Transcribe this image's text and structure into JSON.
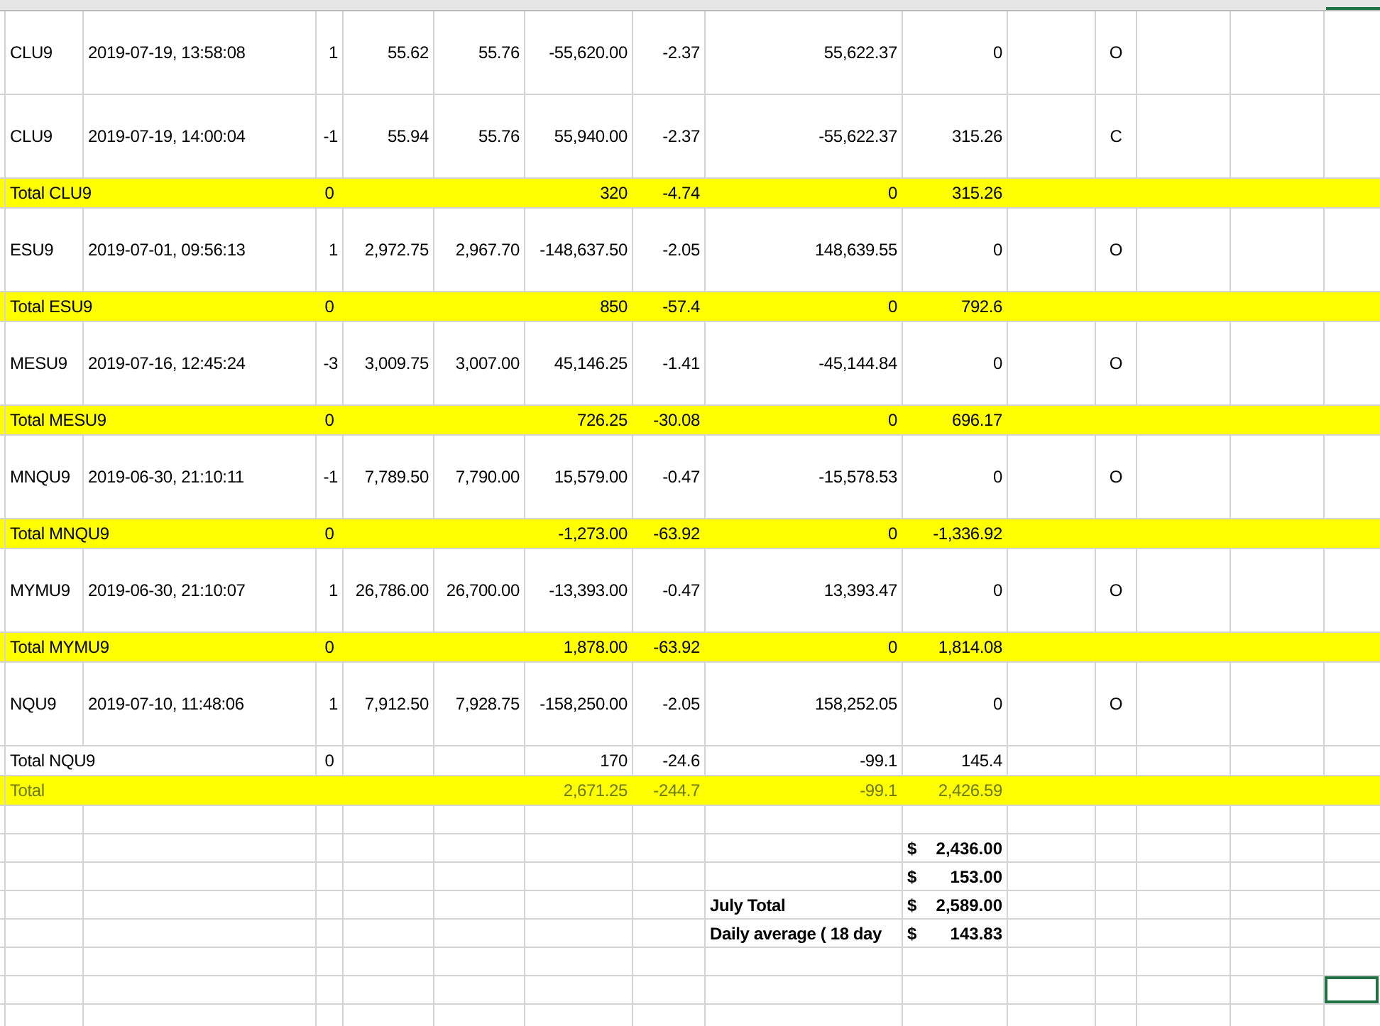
{
  "rows": [
    {
      "kind": "trade",
      "highlighted": false,
      "selected": false,
      "cells": {
        "column_1": "CLU9",
        "column_2": "2019-07-19, 13:58:08",
        "column_3": "1",
        "column_4": "55.62",
        "column_5": "55.76",
        "column_6": "-55,620.00",
        "column_7": "-2.37",
        "column_8": "55,622.37",
        "column_9": "0",
        "column_11": "O"
      }
    },
    {
      "kind": "trade",
      "highlighted": false,
      "selected": false,
      "cells": {
        "column_1": "CLU9",
        "column_2": "2019-07-19, 14:00:04",
        "column_3": "-1",
        "column_4": "55.94",
        "column_5": "55.76",
        "column_6": "55,940.00",
        "column_7": "-2.37",
        "column_8": "-55,622.37",
        "column_9": "315.26",
        "column_11": "C"
      }
    },
    {
      "kind": "subtotal",
      "highlighted": true,
      "selected": false,
      "cells": {
        "column_1": "Total CLU9",
        "column_3": "0",
        "column_6": "320",
        "column_7": "-4.74",
        "column_8": "0",
        "column_9": "315.26"
      }
    },
    {
      "kind": "trade",
      "highlighted": false,
      "selected": false,
      "cells": {
        "column_1": "ESU9",
        "column_2": "2019-07-01, 09:56:13",
        "column_3": "1",
        "column_4": "2,972.75",
        "column_5": "2,967.70",
        "column_6": "-148,637.50",
        "column_7": "-2.05",
        "column_8": "148,639.55",
        "column_9": "0",
        "column_11": "O"
      }
    },
    {
      "kind": "subtotal",
      "highlighted": true,
      "selected": false,
      "cells": {
        "column_1": "Total ESU9",
        "column_3": "0",
        "column_6": "850",
        "column_7": "-57.4",
        "column_8": "0",
        "column_9": "792.6"
      }
    },
    {
      "kind": "trade",
      "highlighted": false,
      "selected": false,
      "cells": {
        "column_1": "MESU9",
        "column_2": "2019-07-16, 12:45:24",
        "column_3": "-3",
        "column_4": "3,009.75",
        "column_5": "3,007.00",
        "column_6": "45,146.25",
        "column_7": "-1.41",
        "column_8": "-45,144.84",
        "column_9": "0",
        "column_11": "O"
      }
    },
    {
      "kind": "subtotal",
      "highlighted": true,
      "selected": false,
      "cells": {
        "column_1": "Total MESU9",
        "column_3": "0",
        "column_6": "726.25",
        "column_7": "-30.08",
        "column_8": "0",
        "column_9": "696.17"
      }
    },
    {
      "kind": "trade",
      "highlighted": false,
      "selected": false,
      "cells": {
        "column_1": "MNQU9",
        "column_2": "2019-06-30, 21:10:11",
        "column_3": "-1",
        "column_4": "7,789.50",
        "column_5": "7,790.00",
        "column_6": "15,579.00",
        "column_7": "-0.47",
        "column_8": "-15,578.53",
        "column_9": "0",
        "column_11": "O"
      }
    },
    {
      "kind": "subtotal",
      "highlighted": true,
      "selected": false,
      "cells": {
        "column_1": "Total MNQU9",
        "column_3": "0",
        "column_6": "-1,273.00",
        "column_7": "-63.92",
        "column_8": "0",
        "column_9": "-1,336.92"
      }
    },
    {
      "kind": "trade",
      "highlighted": false,
      "selected": false,
      "cells": {
        "column_1": "MYMU9",
        "column_2": "2019-06-30, 21:10:07",
        "column_3": "1",
        "column_4": "26,786.00",
        "column_5": "26,700.00",
        "column_6": "-13,393.00",
        "column_7": "-0.47",
        "column_8": "13,393.47",
        "column_9": "0",
        "column_11": "O"
      }
    },
    {
      "kind": "subtotal",
      "highlighted": true,
      "selected": false,
      "cells": {
        "column_1": "Total MYMU9",
        "column_3": "0",
        "column_6": "1,878.00",
        "column_7": "-63.92",
        "column_8": "0",
        "column_9": "1,814.08"
      }
    },
    {
      "kind": "trade",
      "highlighted": false,
      "selected": false,
      "cells": {
        "column_1": "NQU9",
        "column_2": "2019-07-10, 11:48:06",
        "column_3": "1",
        "column_4": "7,912.50",
        "column_5": "7,928.75",
        "column_6": "-158,250.00",
        "column_7": "-2.05",
        "column_8": "158,252.05",
        "column_9": "0",
        "column_11": "O"
      }
    },
    {
      "kind": "subtotal",
      "highlighted": false,
      "selected": false,
      "cells": {
        "column_1": "Total NQU9",
        "column_3": "0",
        "column_6": "170",
        "column_7": "-24.6",
        "column_8": "-99.1",
        "column_9": "145.4"
      }
    },
    {
      "kind": "grand_total",
      "highlighted": true,
      "selected": false,
      "cells": {
        "column_1": "Total",
        "column_6": "2,671.25",
        "column_7": "-244.7",
        "column_8": "-99.1",
        "column_9": "2,426.59"
      }
    },
    {
      "kind": "blank",
      "highlighted": false,
      "selected": false
    },
    {
      "kind": "summary",
      "highlighted": false,
      "selected": false,
      "currency": "$",
      "amount": "2,436.00"
    },
    {
      "kind": "summary",
      "highlighted": false,
      "selected": false,
      "currency": "$",
      "amount": "153.00"
    },
    {
      "kind": "summary",
      "highlighted": false,
      "selected": false,
      "label": "July Total",
      "currency": "$",
      "amount": "2,589.00"
    },
    {
      "kind": "summary",
      "highlighted": false,
      "selected": false,
      "label": "Daily average ( 18 day",
      "currency": "$",
      "amount": "143.83"
    },
    {
      "kind": "blank",
      "highlighted": false,
      "selected": false
    },
    {
      "kind": "blank",
      "highlighted": false,
      "selected": true
    },
    {
      "kind": "blank",
      "highlighted": false,
      "selected": false
    }
  ]
}
